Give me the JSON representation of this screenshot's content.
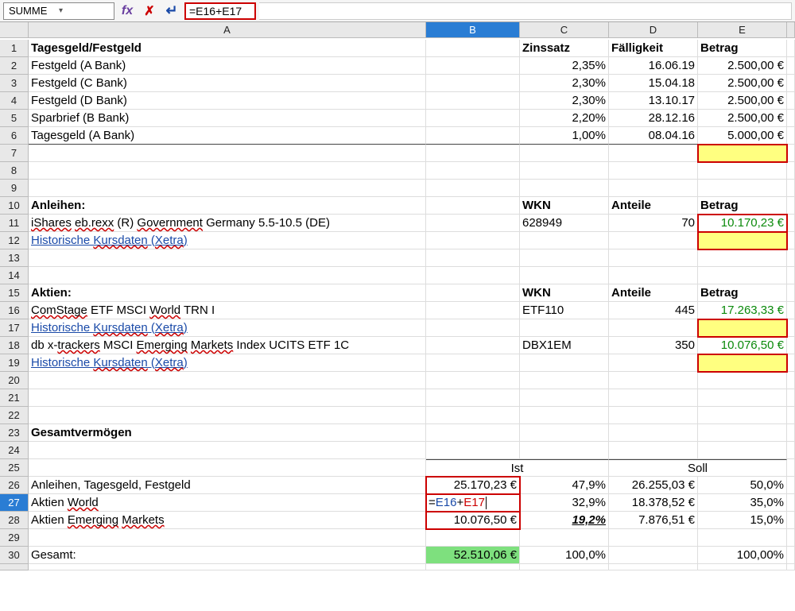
{
  "formula_bar": {
    "name_box": "SUMME",
    "formula": "=E16+E17"
  },
  "columns": [
    "A",
    "B",
    "C",
    "D",
    "E"
  ],
  "selected_column": "B",
  "selected_row": 27,
  "rows": {
    "1": {
      "A": "Tagesgeld/Festgeld",
      "C": "Zinssatz",
      "D": "Fälligkeit",
      "E": "Betrag"
    },
    "2": {
      "A": "Festgeld (A Bank)",
      "C": "2,35%",
      "D": "16.06.19",
      "E": "2.500,00 €"
    },
    "3": {
      "A": "Festgeld (C Bank)",
      "C": "2,30%",
      "D": "15.04.18",
      "E": "2.500,00 €"
    },
    "4": {
      "A": "Festgeld (D Bank)",
      "C": "2,30%",
      "D": "13.10.17",
      "E": "2.500,00 €"
    },
    "5": {
      "A": "Sparbrief (B Bank)",
      "C": "2,20%",
      "D": "28.12.16",
      "E": "2.500,00 €"
    },
    "6": {
      "A": "Tagesgeld (A Bank)",
      "C": "1,00%",
      "D": "08.04.16",
      "E": "5.000,00 €"
    },
    "10": {
      "A": "Anleihen:",
      "C": "WKN",
      "D": "Anteile",
      "E": "Betrag"
    },
    "11": {
      "A": "iShares eb.rexx (R) Government Germany 5.5-10.5 (DE)",
      "C": "628949",
      "D": "70",
      "E": "10.170,23 €"
    },
    "12": {
      "A": "Historische Kursdaten (Xetra)"
    },
    "15": {
      "A": "Aktien:",
      "C": "WKN",
      "D": "Anteile",
      "E": "Betrag"
    },
    "16": {
      "A": "ComStage ETF MSCI World TRN I",
      "C": "ETF110",
      "D": "445",
      "E": "17.263,33 €"
    },
    "17": {
      "A": "Historische Kursdaten (Xetra)"
    },
    "18": {
      "A": "db x-trackers MSCI Emerging Markets Index UCITS ETF 1C",
      "C": "DBX1EM",
      "D": "350",
      "E": "10.076,50 €"
    },
    "19": {
      "A": "Historische Kursdaten (Xetra)"
    },
    "23": {
      "A": "Gesamtvermögen"
    },
    "25": {
      "BC": "Ist",
      "DE": "Soll"
    },
    "26": {
      "A": "Anleihen, Tagesgeld, Festgeld",
      "B": "25.170,23 €",
      "C": "47,9%",
      "D": "26.255,03 €",
      "E": "50,0%"
    },
    "27": {
      "A": "Aktien World",
      "B_formula_o1": "E16",
      "B_formula_o2": "E17",
      "C": "32,9%",
      "D": "18.378,52 €",
      "E": "35,0%"
    },
    "28": {
      "A": "Aktien Emerging Markets",
      "B": "10.076,50 €",
      "C": "19,2%",
      "D": "7.876,51 €",
      "E": "15,0%"
    },
    "30": {
      "A": "Gesamt:",
      "B": "52.510,06 €",
      "C": "100,0%",
      "E": "100,00%"
    }
  },
  "squiggle_tokens": [
    "Kursdaten",
    "Xetra",
    "iShares",
    "eb.rexx",
    "Government",
    "ComStage",
    "World",
    "trackers",
    "Emerging",
    "Markets"
  ]
}
